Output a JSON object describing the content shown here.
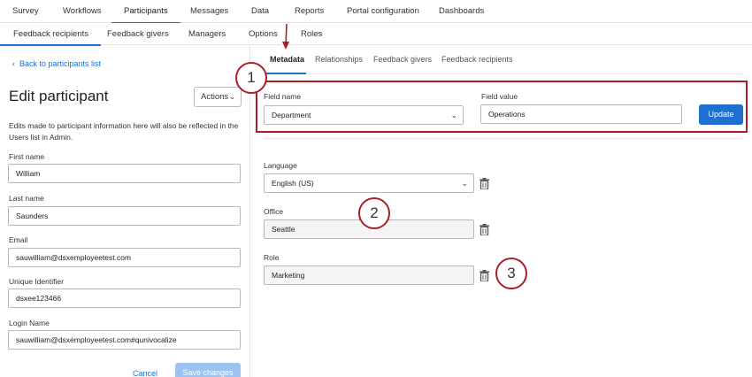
{
  "top_nav": {
    "tabs": [
      {
        "label": "Survey"
      },
      {
        "label": "Workflows"
      },
      {
        "label": "Participants"
      },
      {
        "label": "Messages"
      },
      {
        "label": "Data"
      },
      {
        "label": "Reports"
      },
      {
        "label": "Portal configuration"
      },
      {
        "label": "Dashboards"
      }
    ],
    "active": "Participants"
  },
  "sub_nav": {
    "tabs": [
      {
        "label": "Feedback recipients"
      },
      {
        "label": "Feedback givers"
      },
      {
        "label": "Managers"
      },
      {
        "label": "Options"
      },
      {
        "label": "Roles"
      }
    ],
    "active": "Feedback recipients"
  },
  "left_panel": {
    "back_link": "Back to participants list",
    "title": "Edit participant",
    "actions_label": "Actions",
    "description": "Edits made to participant information here will also be reflected in the Users list in Admin.",
    "fields": [
      {
        "label": "First name",
        "value": "William"
      },
      {
        "label": "Last name",
        "value": "Saunders"
      },
      {
        "label": "Email",
        "value": "sauwilliam@dsxemployeetest.com"
      },
      {
        "label": "Unique Identifier",
        "value": "dsxee123466"
      },
      {
        "label": "Login Name",
        "value": "sauwilliam@dsxemployeetest.com#qunivocalize"
      }
    ],
    "cancel_label": "Cancel",
    "save_label": "Save changes"
  },
  "right_panel": {
    "tabs": [
      {
        "label": "Metadata"
      },
      {
        "label": "Relationships"
      },
      {
        "label": "Feedback givers"
      },
      {
        "label": "Feedback recipients"
      }
    ],
    "active_tab": "Metadata",
    "field_name_label": "Field name",
    "field_name_value": "Department",
    "field_value_label": "Field value",
    "field_value_value": "Operations",
    "update_label": "Update",
    "metadata": [
      {
        "label": "Language",
        "value": "English (US)",
        "type": "select"
      },
      {
        "label": "Office",
        "value": "Seattle",
        "type": "text"
      },
      {
        "label": "Role",
        "value": "Marketing",
        "type": "text"
      }
    ]
  },
  "callouts": [
    "1",
    "2",
    "3"
  ],
  "colors": {
    "accent": "#1f6fd1",
    "callout": "#a81f2a",
    "disabled_button": "#9cc3ef"
  },
  "icons": {
    "back": "chevron-left-icon",
    "dropdown": "chevron-down-icon",
    "delete": "trash-icon",
    "pointer": "arrow-down-icon"
  }
}
